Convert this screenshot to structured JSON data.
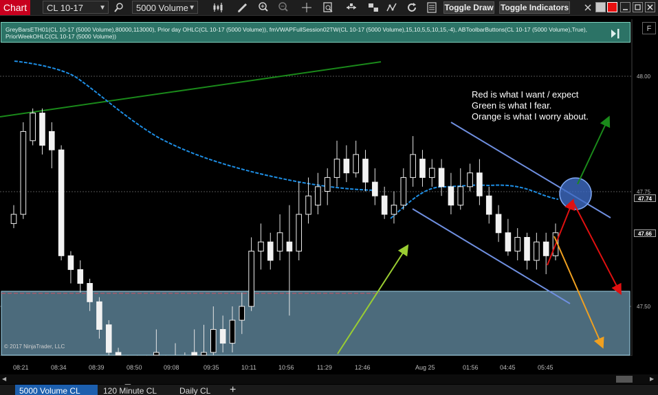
{
  "toolbar": {
    "app_title": "Chart",
    "instrument": "CL 10-17",
    "bar_type": "5000 Volume",
    "toggle_draw": "Toggle Draw",
    "toggle_indicators": "Toggle Indicators"
  },
  "indicators": {
    "line1": "GreyBarsETH01(CL 10-17 (5000 Volume),80000,113000), Prior day OHLC(CL 10-17 (5000 Volume)), fmVWAPFullSession02TW(CL 10-17 (5000 Volume),15,10,5,5,10,15,-4), ABToolbarButtons(CL 10-17 (5000 Volume),True),",
    "line2": "PriorWeekOHLC(CL 10-17 (5000 Volume))"
  },
  "price_axis": {
    "f_button": "F",
    "labels": [
      "48.00",
      "47.75",
      "47.66",
      "47.50"
    ],
    "tags": [
      "47.74",
      "47.66"
    ]
  },
  "time_axis": {
    "labels": [
      "08:21",
      "08:34",
      "08:39",
      "08:50",
      "09:08",
      "09:35",
      "10:11",
      "10:56",
      "11:29",
      "12:46",
      "Aug 25",
      "01:56",
      "04:45",
      "05:45"
    ]
  },
  "annotation": {
    "lines": [
      "Red is what I want / expect",
      "Green is what I fear.",
      "Orange is what I worry about."
    ]
  },
  "copyright": "© 2017 NinjaTrader, LLC",
  "tabs": [
    "5000 Volume CL",
    "120 Minute CL",
    "Daily CL"
  ],
  "add_tab": "+",
  "colors": {
    "title_bg": "#c8001e",
    "indicator_bar": "#2c7366",
    "vwap": "#1e8fe6",
    "green_line": "#1a8a1a",
    "channel": "#6f8fe0",
    "zone_fill": "#4c6b7c",
    "arrow_red": "#e01010",
    "arrow_green": "#1a8a1a",
    "arrow_orange": "#f0a020",
    "arrow_lime": "#9acd32",
    "circle": "#4a7fd8",
    "tab_active": "#1c5fae"
  },
  "chart_data": {
    "type": "candlestick",
    "instrument": "CL 10-17",
    "bar_type": "5000 Volume",
    "price_labels": [
      48.0,
      47.75,
      47.5
    ],
    "price_tags": [
      47.74,
      47.66
    ],
    "time_labels": [
      "08:21",
      "08:34",
      "08:39",
      "08:50",
      "09:08",
      "09:35",
      "10:11",
      "10:56",
      "11:29",
      "12:46",
      "Aug 25",
      "01:56",
      "04:45",
      "05:45"
    ],
    "candles": [
      [
        47.68,
        47.7,
        47.67,
        47.72
      ],
      [
        47.7,
        47.88,
        47.69,
        47.9
      ],
      [
        47.86,
        47.92,
        47.85,
        47.93
      ],
      [
        47.92,
        47.85,
        47.83,
        47.93
      ],
      [
        47.88,
        47.84,
        47.8,
        47.9
      ],
      [
        47.84,
        47.61,
        47.6,
        47.85
      ],
      [
        47.61,
        47.58,
        47.55,
        47.62
      ],
      [
        47.58,
        47.55,
        47.53,
        47.6
      ],
      [
        47.55,
        47.51,
        47.49,
        47.56
      ],
      [
        47.51,
        47.45,
        47.43,
        47.52
      ],
      [
        47.46,
        47.4,
        47.39,
        47.47
      ],
      [
        47.4,
        47.34,
        47.32,
        47.41
      ],
      [
        47.3,
        47.33,
        47.29,
        47.36
      ],
      [
        47.32,
        47.35,
        47.3,
        47.38
      ],
      [
        47.35,
        47.33,
        47.3,
        47.37
      ],
      [
        47.38,
        47.4,
        47.32,
        47.45
      ],
      [
        47.35,
        47.36,
        47.33,
        47.38
      ],
      [
        47.35,
        47.38,
        47.34,
        47.42
      ],
      [
        47.38,
        47.36,
        47.34,
        47.4
      ],
      [
        47.4,
        47.38,
        47.3,
        47.45
      ],
      [
        47.37,
        47.4,
        47.33,
        47.46
      ],
      [
        47.4,
        47.45,
        47.38,
        47.5
      ],
      [
        47.45,
        47.42,
        47.4,
        47.48
      ],
      [
        47.42,
        47.47,
        47.4,
        47.5
      ],
      [
        47.47,
        47.5,
        47.44,
        47.53
      ],
      [
        47.5,
        47.62,
        47.49,
        47.65
      ],
      [
        47.62,
        47.64,
        47.58,
        47.68
      ],
      [
        47.64,
        47.6,
        47.58,
        47.66
      ],
      [
        47.62,
        47.66,
        47.6,
        47.7
      ],
      [
        47.64,
        47.62,
        47.48,
        47.72
      ],
      [
        47.62,
        47.7,
        47.6,
        47.77
      ],
      [
        47.7,
        47.74,
        47.68,
        47.78
      ],
      [
        47.72,
        47.76,
        47.7,
        47.79
      ],
      [
        47.75,
        47.78,
        47.72,
        47.8
      ],
      [
        47.78,
        47.82,
        47.76,
        47.86
      ],
      [
        47.82,
        47.79,
        47.77,
        47.85
      ],
      [
        47.79,
        47.83,
        47.78,
        47.86
      ],
      [
        47.82,
        47.77,
        47.75,
        47.84
      ],
      [
        47.77,
        47.74,
        47.72,
        47.8
      ],
      [
        47.74,
        47.7,
        47.69,
        47.76
      ],
      [
        47.7,
        47.72,
        47.68,
        47.75
      ],
      [
        47.72,
        47.78,
        47.71,
        47.8
      ],
      [
        47.78,
        47.83,
        47.76,
        47.87
      ],
      [
        47.82,
        47.78,
        47.76,
        47.84
      ],
      [
        47.78,
        47.8,
        47.76,
        47.82
      ],
      [
        47.8,
        47.76,
        47.74,
        47.82
      ],
      [
        47.76,
        47.72,
        47.7,
        47.79
      ],
      [
        47.72,
        47.76,
        47.71,
        47.8
      ],
      [
        47.76,
        47.79,
        47.75,
        47.81
      ],
      [
        47.79,
        47.74,
        47.72,
        47.82
      ],
      [
        47.74,
        47.7,
        47.68,
        47.76
      ],
      [
        47.7,
        47.66,
        47.64,
        47.72
      ],
      [
        47.66,
        47.62,
        47.61,
        47.69
      ],
      [
        47.62,
        47.65,
        47.6,
        47.67
      ],
      [
        47.65,
        47.6,
        47.58,
        47.66
      ],
      [
        47.6,
        47.64,
        47.58,
        47.66
      ],
      [
        47.64,
        47.61,
        47.57,
        47.66
      ],
      [
        47.61,
        47.66,
        47.6,
        47.68
      ]
    ]
  }
}
